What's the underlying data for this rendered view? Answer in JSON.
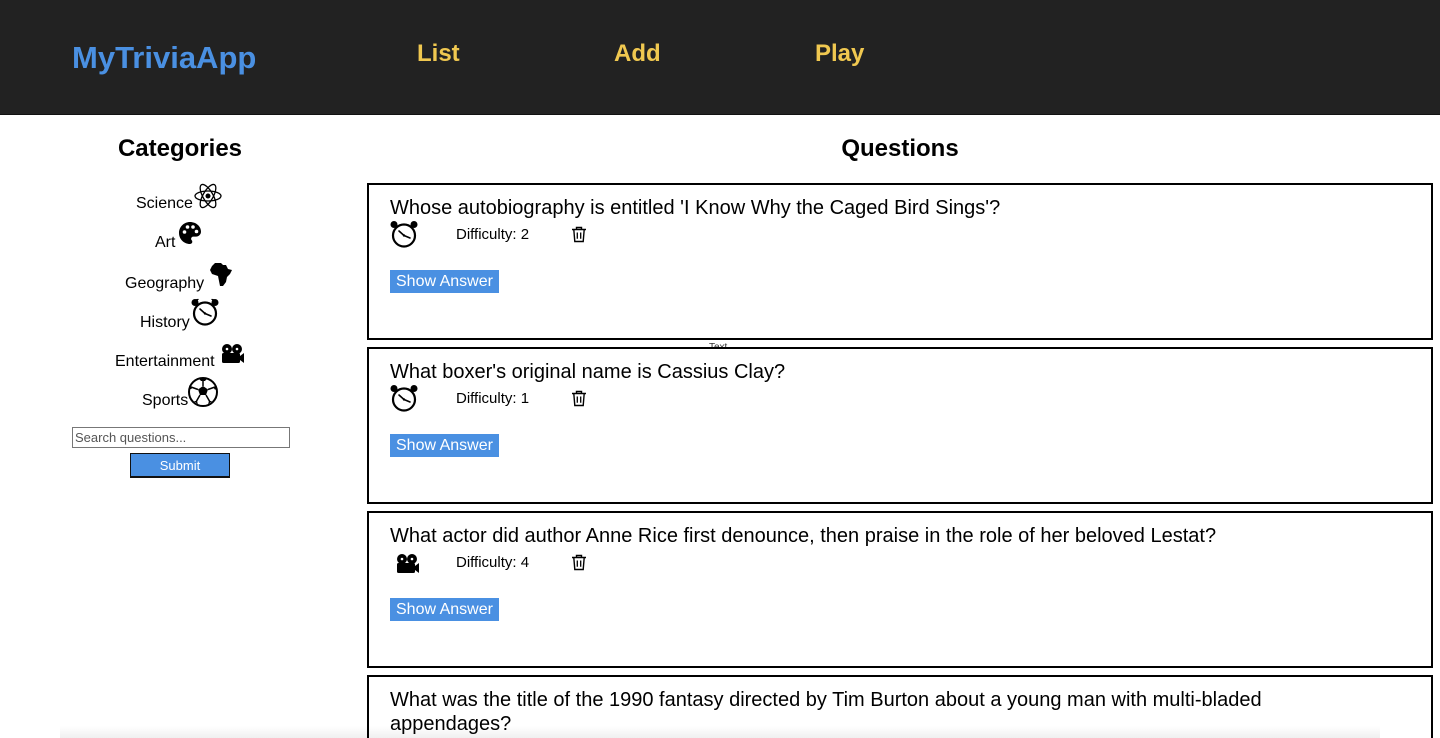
{
  "header": {
    "brand": "MyTriviaApp",
    "nav": [
      {
        "label": "List"
      },
      {
        "label": "Add"
      },
      {
        "label": "Play"
      }
    ],
    "background": "#222222",
    "brand_color": "#4a90e2",
    "nav_color": "#f0c850"
  },
  "sidebar": {
    "title": "Categories",
    "categories": [
      {
        "label": "Science",
        "icon": "atom-icon"
      },
      {
        "label": "Art",
        "icon": "palette-icon"
      },
      {
        "label": "Geography",
        "icon": "africa-icon"
      },
      {
        "label": "History",
        "icon": "alarm-clock-icon"
      },
      {
        "label": "Entertainment",
        "icon": "film-projector-icon"
      },
      {
        "label": "Sports",
        "icon": "soccer-ball-icon"
      }
    ],
    "search": {
      "placeholder": "Search questions...",
      "value": ""
    },
    "submit_label": "Submit"
  },
  "main": {
    "title": "Questions",
    "difficulty_prefix": "Difficulty:",
    "show_answer_label": "Show Answer",
    "floating_label": "Text",
    "questions": [
      {
        "text": "Whose autobiography is entitled 'I Know Why the Caged Bird Sings'?",
        "icon": "alarm-clock-icon",
        "difficulty": "Difficulty: 2"
      },
      {
        "text": "What boxer's original name is Cassius Clay?",
        "icon": "alarm-clock-icon",
        "difficulty": "Difficulty: 1"
      },
      {
        "text": "What actor did author Anne Rice first denounce, then praise in the role of her beloved Lestat?",
        "icon": "film-projector-icon",
        "difficulty": "Difficulty: 4"
      },
      {
        "text": "What was the title of the 1990 fantasy directed by Tim Burton about a young man with multi-bladed appendages?"
      }
    ]
  },
  "colors": {
    "accent": "#4a90e2",
    "nav_text": "#f0c850",
    "card_border": "#000000"
  }
}
